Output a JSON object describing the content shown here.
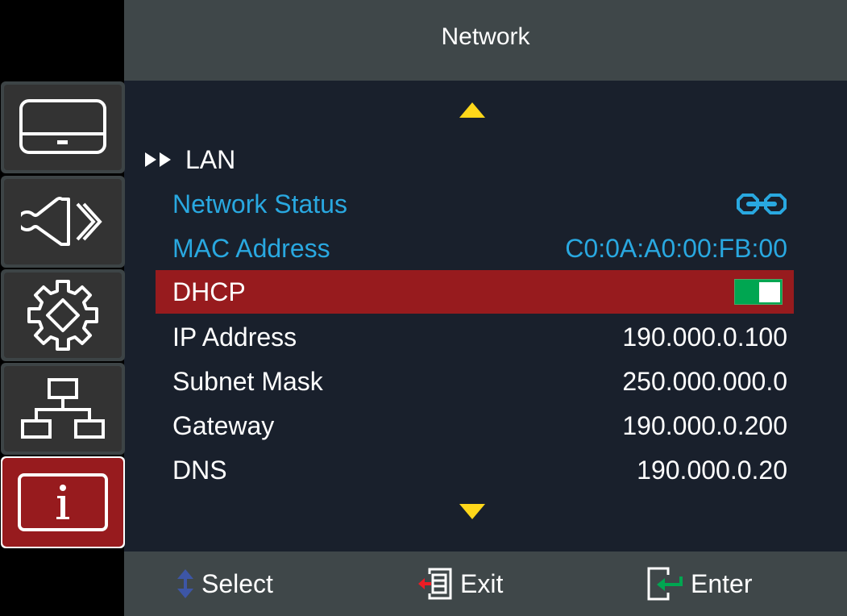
{
  "header": {
    "title": "Network"
  },
  "sidebar": {
    "items": [
      {
        "name": "display",
        "icon": "monitor-icon",
        "active": false
      },
      {
        "name": "audio",
        "icon": "speaker-icon",
        "active": false
      },
      {
        "name": "settings",
        "icon": "gear-icon",
        "active": false
      },
      {
        "name": "network",
        "icon": "network-tree-icon",
        "active": false
      },
      {
        "name": "information",
        "icon": "info-icon",
        "active": true
      }
    ]
  },
  "main": {
    "scroll_up_icon": "triangle-up-icon",
    "scroll_down_icon": "triangle-down-icon",
    "section": {
      "icon": "double-triangle-right-icon",
      "label": "LAN"
    },
    "rows": [
      {
        "label": "Network Status",
        "value": "",
        "value_icon": "link-connected-icon",
        "style": "info"
      },
      {
        "label": "MAC Address",
        "value": "C0:0A:A0:00:FB:00",
        "style": "info"
      },
      {
        "label": "DHCP",
        "value": "",
        "toggle": true,
        "toggle_state": "on",
        "style": "selected"
      },
      {
        "label": "IP Address",
        "value": "190.000.0.100",
        "style": "normal"
      },
      {
        "label": "Subnet Mask",
        "value": "250.000.000.0",
        "style": "normal"
      },
      {
        "label": "Gateway",
        "value": "190.000.0.200",
        "style": "normal"
      },
      {
        "label": "DNS",
        "value": "190.000.0.20",
        "style": "normal"
      }
    ]
  },
  "footer": {
    "hints": [
      {
        "icon": "up-down-arrow-icon",
        "label": "Select"
      },
      {
        "icon": "exit-menu-icon",
        "label": "Exit"
      },
      {
        "icon": "enter-icon",
        "label": "Enter"
      }
    ]
  },
  "colors": {
    "header_bg": "#3f4749",
    "main_bg": "#19202c",
    "selected_bg": "#971b1e",
    "info_text": "#29a8e0",
    "scroll_arrow": "#ffd71a",
    "toggle_on": "#00a651"
  }
}
